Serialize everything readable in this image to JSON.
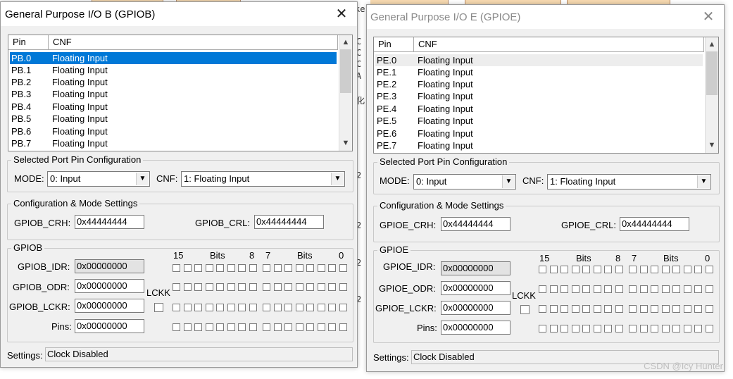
{
  "background": {
    "tab_color": "#f6d9b0",
    "partial_tab_text": "ke",
    "side_chars": [
      "C",
      "C",
      "C",
      "A",
      "化",
      "2",
      "2",
      "2",
      "2"
    ]
  },
  "gpiob": {
    "title": "General Purpose I/O B (GPIOB)",
    "close": "✕",
    "list": {
      "headers": [
        "Pin",
        "CNF"
      ],
      "rows": [
        {
          "pin": "PB.0",
          "cnf": "Floating Input"
        },
        {
          "pin": "PB.1",
          "cnf": "Floating Input"
        },
        {
          "pin": "PB.2",
          "cnf": "Floating Input"
        },
        {
          "pin": "PB.3",
          "cnf": "Floating Input"
        },
        {
          "pin": "PB.4",
          "cnf": "Floating Input"
        },
        {
          "pin": "PB.5",
          "cnf": "Floating Input"
        },
        {
          "pin": "PB.6",
          "cnf": "Floating Input"
        },
        {
          "pin": "PB.7",
          "cnf": "Floating Input"
        }
      ]
    },
    "pin_config": {
      "group_label": "Selected Port Pin Configuration",
      "mode_label": "MODE:",
      "mode_value": "0: Input",
      "cnf_label": "CNF:",
      "cnf_value": "1: Floating Input"
    },
    "config_mode": {
      "group_label": "Configuration & Mode Settings",
      "crh_label": "GPIOB_CRH:",
      "crh_value": "0x44444444",
      "crl_label": "GPIOB_CRL:",
      "crl_value": "0x44444444"
    },
    "port": {
      "group_label": "GPIOB",
      "bits_hi": {
        "left": "15",
        "mid": "Bits",
        "right": "8"
      },
      "bits_lo": {
        "left": "7",
        "mid": "Bits",
        "right": "0"
      },
      "idr_label": "GPIOB_IDR:",
      "idr_value": "0x00000000",
      "odr_label": "GPIOB_ODR:",
      "odr_value": "0x00000000",
      "lckr_label": "GPIOB_LCKR:",
      "lckr_value": "0x00000000",
      "lckk_label": "LCKK",
      "pins_label": "Pins:",
      "pins_value": "0x00000000"
    },
    "status": {
      "label": "Settings:",
      "value": "Clock Disabled"
    }
  },
  "gpioe": {
    "title": "General Purpose I/O E (GPIOE)",
    "close": "✕",
    "list": {
      "headers": [
        "Pin",
        "CNF"
      ],
      "rows": [
        {
          "pin": "PE.0",
          "cnf": "Floating Input"
        },
        {
          "pin": "PE.1",
          "cnf": "Floating Input"
        },
        {
          "pin": "PE.2",
          "cnf": "Floating Input"
        },
        {
          "pin": "PE.3",
          "cnf": "Floating Input"
        },
        {
          "pin": "PE.4",
          "cnf": "Floating Input"
        },
        {
          "pin": "PE.5",
          "cnf": "Floating Input"
        },
        {
          "pin": "PE.6",
          "cnf": "Floating Input"
        },
        {
          "pin": "PE.7",
          "cnf": "Floating Input"
        }
      ]
    },
    "pin_config": {
      "group_label": "Selected Port Pin Configuration",
      "mode_label": "MODE:",
      "mode_value": "0: Input",
      "cnf_label": "CNF:",
      "cnf_value": "1: Floating Input"
    },
    "config_mode": {
      "group_label": "Configuration & Mode Settings",
      "crh_label": "GPIOE_CRH:",
      "crh_value": "0x44444444",
      "crl_label": "GPIOE_CRL:",
      "crl_value": "0x44444444"
    },
    "port": {
      "group_label": "GPIOE",
      "bits_hi": {
        "left": "15",
        "mid": "Bits",
        "right": "8"
      },
      "bits_lo": {
        "left": "7",
        "mid": "Bits",
        "right": "0"
      },
      "idr_label": "GPIOE_IDR:",
      "idr_value": "0x00000000",
      "odr_label": "GPIOE_ODR:",
      "odr_value": "0x00000000",
      "lckr_label": "GPIOE_LCKR:",
      "lckr_value": "0x00000000",
      "lckk_label": "LCKK",
      "pins_label": "Pins:",
      "pins_value": "0x00000000"
    },
    "status": {
      "label": "Settings:",
      "value": "Clock Disabled"
    }
  },
  "watermark": "CSDN @Icy Hunter",
  "colors": {
    "selection": "#0078d7",
    "dialog_bg": "#f0f0f0"
  }
}
